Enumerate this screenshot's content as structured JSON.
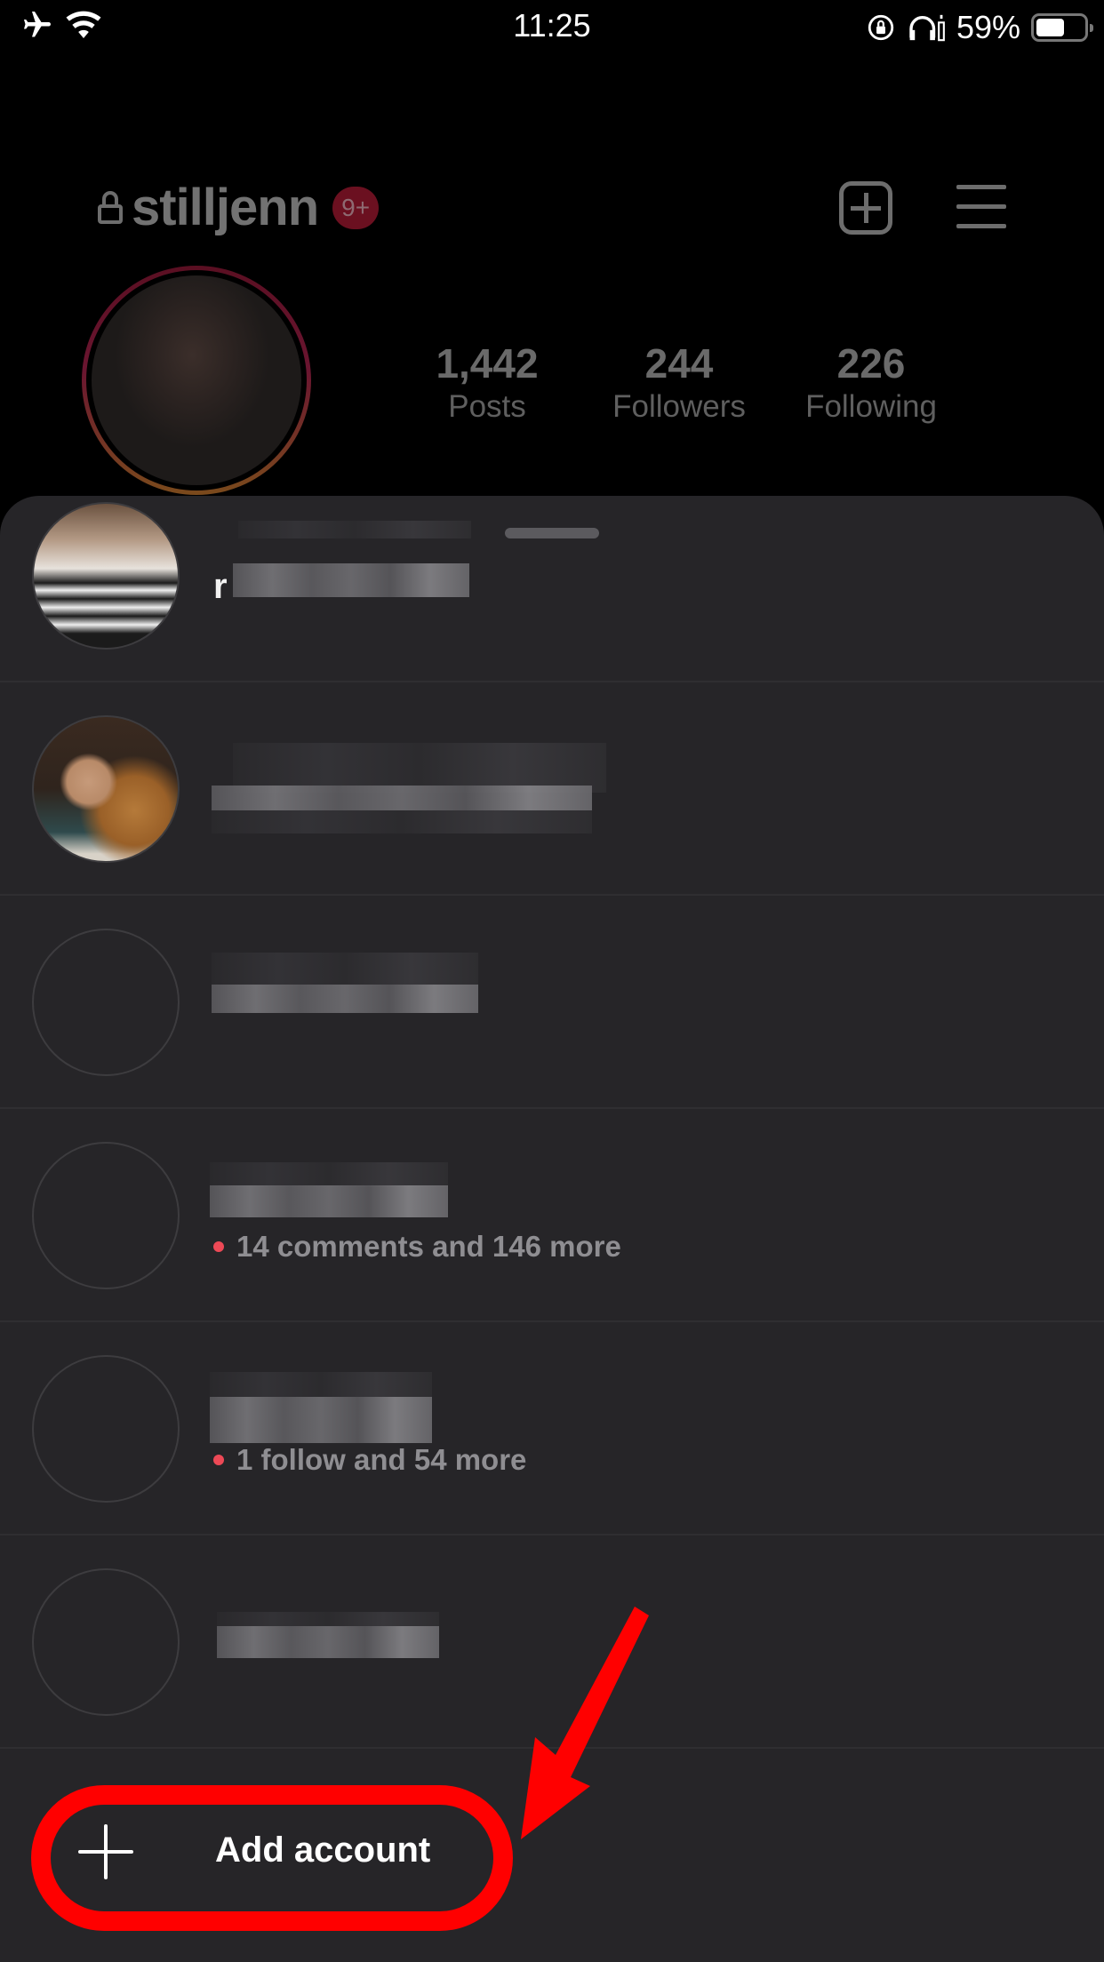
{
  "status_bar": {
    "time": "11:25",
    "battery_percent": "59%",
    "battery_level": 0.59,
    "left_icons": [
      "airplane-icon",
      "wifi-icon"
    ],
    "right_icons": [
      "orientation-lock-icon",
      "headphones-icon"
    ]
  },
  "profile": {
    "username": "stilljenn",
    "notification_badge": "9+",
    "stats": [
      {
        "value": "1,442",
        "label": "Posts"
      },
      {
        "value": "244",
        "label": "Followers"
      },
      {
        "value": "226",
        "label": "Following"
      }
    ],
    "colors": {
      "badge": "#ed4956",
      "ring_start": "#c13584",
      "ring_end": "#f58529"
    }
  },
  "account_switcher": {
    "accounts": [
      {
        "name_visible_prefix": "r",
        "name_obscured": true,
        "activity": null,
        "avatar": "photo"
      },
      {
        "name_visible_prefix": "",
        "name_obscured": true,
        "activity": null,
        "avatar": "photo"
      },
      {
        "name_visible_prefix": "",
        "name_obscured": true,
        "activity": null,
        "avatar": "empty"
      },
      {
        "name_visible_prefix": "",
        "name_obscured": true,
        "activity": "14 comments and 146 more",
        "avatar": "empty"
      },
      {
        "name_visible_prefix": "",
        "name_obscured": true,
        "activity": "1 follow and 54 more",
        "avatar": "empty"
      },
      {
        "name_visible_prefix": "",
        "name_obscured": true,
        "activity": null,
        "avatar": "empty"
      }
    ],
    "add_account_label": "Add account",
    "activity_dot_color": "#ed4956"
  },
  "annotation": {
    "type": "highlight-with-arrow",
    "target": "add-account-button",
    "color": "#ff0000"
  }
}
